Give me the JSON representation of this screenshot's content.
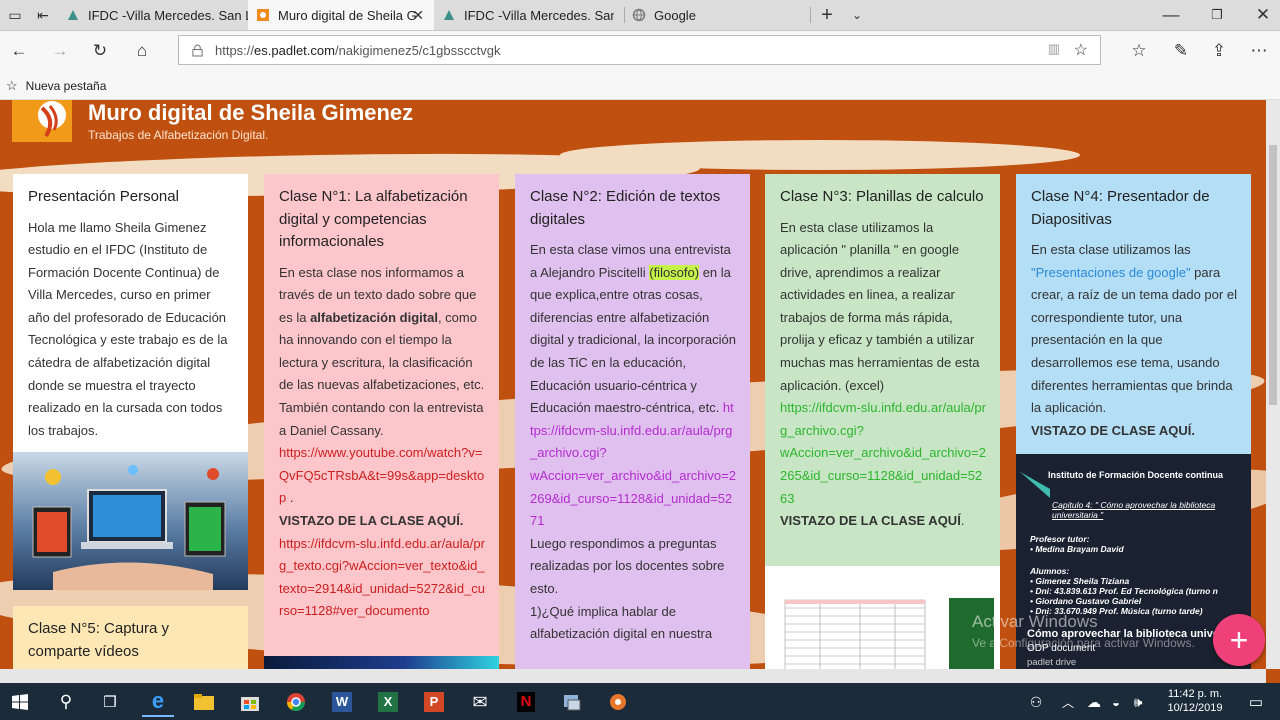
{
  "browser": {
    "tabs": [
      {
        "label": "IFDC -Villa Mercedes. San Lu"
      },
      {
        "label": "Muro digital de Sheila G"
      },
      {
        "label": "IFDC -Villa Mercedes. San L"
      },
      {
        "label": "Google"
      }
    ],
    "url_prefix": "https://",
    "url_host": "es.padlet.com",
    "url_path": "/nakigimenez5/c1gbsscctvgk",
    "favorites": [
      {
        "label": "Nueva pestaña"
      }
    ]
  },
  "padlet": {
    "title": "Muro digital de Sheila Gimenez",
    "subtitle": "Trabajos de Alfabetización Digital.",
    "cards": [
      {
        "title": "Presentación Personal",
        "body": "Hola me llamo Sheila Gimenez estudio en el IFDC (Instituto de Formación Docente Continua) de Villa Mercedes, curso en primer año del profesorado de Educación Tecnológica  y este trabajo es de la cátedra de alfabetización digital donde se muestra el trayecto realizado en la cursada con todos los trabajos."
      },
      {
        "title": "Clase N°1:  La alfabetización digital y competencias informacionales",
        "body_a": "En esta clase nos informamos a través de un texto dado sobre que es la ",
        "body_bold": "alfabetización digital",
        "body_b": ", como ha innovando con el tiempo la lectura y escritura, la clasificación de las nuevas alfabetizaciones, etc. También contando con la entrevista a Daniel Cassany.",
        "link1": "https://www.youtube.com/watch?v=QvFQ5cTRsbA&t=99s&app=desktop",
        "link1_suffix": " .",
        "cta": "VISTAZO DE LA CLASE AQUÍ.",
        "link2": "https://ifdcvm-slu.infd.edu.ar/aula/prg_texto.cgi?wAccion=ver_texto&id_texto=2914&id_unidad=5272&id_curso=1128#ver_documento"
      },
      {
        "title": "Clase N°2:  Edición de textos digitales",
        "body_a": "En esta clase vimos una entrevista a  Alejandro Piscitelli ",
        "body_hl": "(filosofo)",
        "body_b": " en la que explica,entre otras cosas, diferencias entre alfabetización digital y tradicional,  la incorporación de las TiC en la educación, Educación usuario-céntrica y Educación maestro-céntrica, etc. ",
        "link1": "https://ifdcvm-slu.infd.edu.ar/aula/prg_archivo.cgi?",
        "link2": "wAccion=ver_archivo&id_archivo=2269&id_curso=1128&id_unidad=5271",
        "body_c": "Luego respondimos a preguntas realizadas por los docentes sobre esto.",
        "body_d": "1)¿Qué implica hablar de alfabetización digital en nuestra"
      },
      {
        "title": "Clase N°3: Planillas de calculo",
        "body": "En esta clase utilizamos la aplicación  \" planilla \" en google drive, aprendimos a realizar actividades en linea, a realizar trabajos de forma más rápida, prolija y eficaz y también a utilizar muchas mas herramientas de esta aplicación. (excel)",
        "link1": "https://ifdcvm-slu.infd.edu.ar/aula/prg_archivo.cgi?",
        "link2": "wAccion=ver_archivo&id_archivo=2265&id_curso=1128&id_unidad=5263",
        "cta": "VISTAZO DE LA CLASE AQUÍ",
        "cta_suffix": "."
      },
      {
        "title": "Clase N°4:  Presentador de Diapositivas",
        "body_a": "En esta clase utilizamos las ",
        "link1": "\"Presentaciones de google\"",
        "body_b": " para crear, a raíz de un tema dado por el correspondiente tutor, una presentación en la que desarrollemos ese tema, usando diferentes herramientas que brinda la aplicación.",
        "cta": "VISTAZO DE CLASE AQUÍ."
      },
      {
        "title": "Clase N°5: Captura y comparte vídeos"
      }
    ],
    "slide": {
      "institute": "Instituto de Formación Docente continua",
      "chapter": "Capitulo 4: \" Cómo aprovechar la biblioteca universitaria \"",
      "tutor_label": "Profesor tutor:",
      "tutor": "• Medina Brayam David",
      "students_label": "Alumnos:",
      "students": [
        "• Gimenez Sheila Tiziana",
        "• Dni: 43.839.613 Prof. Ed Tecnológica (turno n",
        "• Giordano Gustavo Gabriel",
        "• Dni: 33.670.949 Prof. Música (turno tarde)"
      ],
      "doc_title": "Cómo aprovechar la biblioteca unive",
      "doc_type": "ODP document",
      "doc_source": "padlet drive"
    },
    "watermark_title": "Activar Windows",
    "watermark_sub": "Ve a Configuración para activar Windows."
  },
  "taskbar": {
    "time": "11:42 p. m.",
    "date": "10/12/2019"
  }
}
